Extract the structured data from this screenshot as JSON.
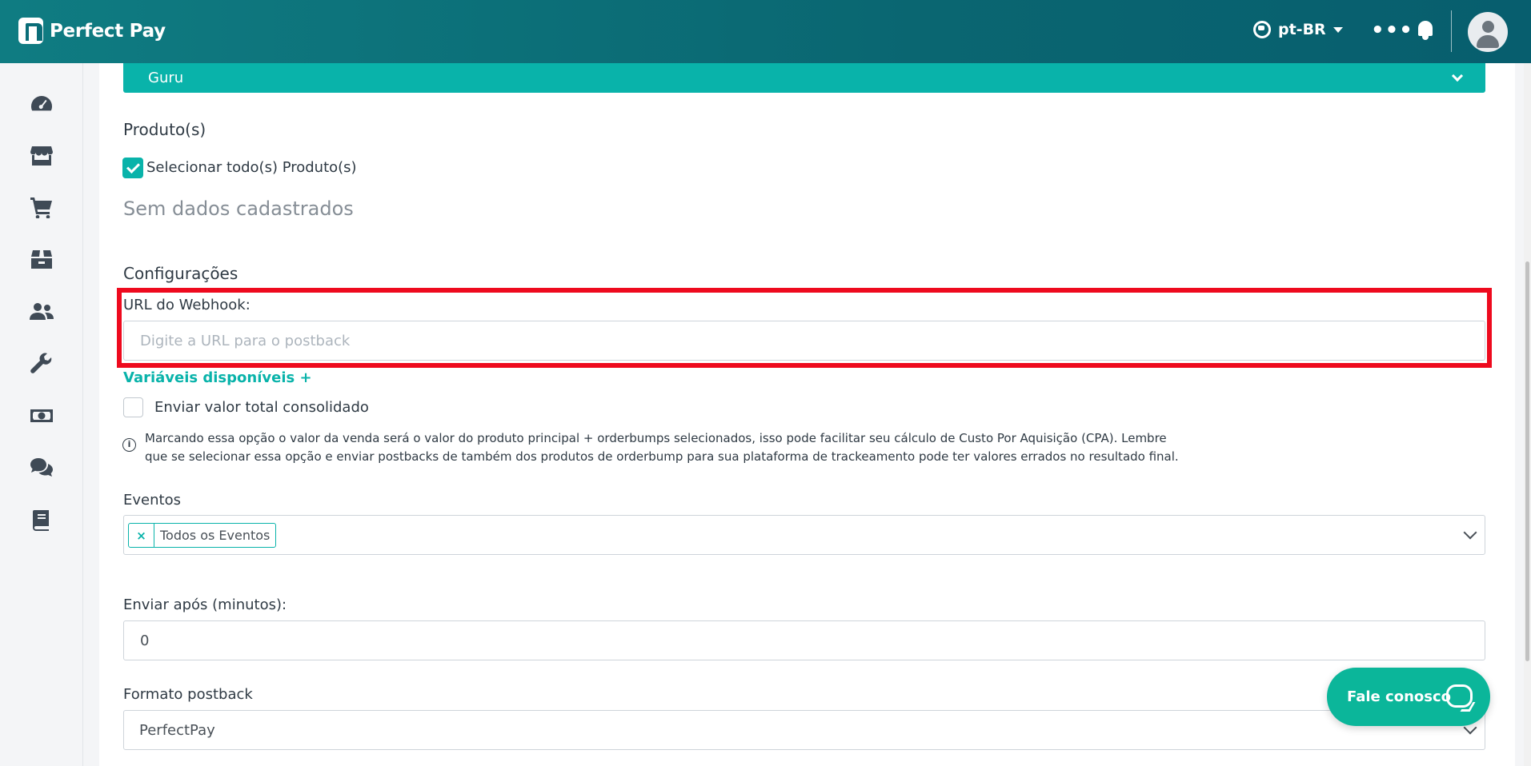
{
  "header": {
    "brand": "Perfect Pay",
    "language": "pt-BR",
    "more_label": "•••"
  },
  "sidebar": {
    "icons": [
      "dashboard-icon",
      "store-icon",
      "cart-icon",
      "box-icon",
      "users-icon",
      "wrench-icon",
      "money-icon",
      "chat-icon",
      "book-icon"
    ]
  },
  "integration": {
    "selected": "Guru"
  },
  "products": {
    "title": "Produto(s)",
    "select_all_label": "Selecionar todo(s) Produto(s)",
    "select_all_checked": true,
    "empty_state": "Sem dados cadastrados"
  },
  "settings": {
    "title": "Configurações",
    "webhook_label": "URL do Webhook:",
    "webhook_value": "",
    "webhook_placeholder": "Digite a URL para o postback",
    "variables_link": "Variáveis disponíveis +",
    "consolidated_label": "Enviar valor total consolidado",
    "consolidated_checked": false,
    "help_text": "Marcando essa opção o valor da venda será o valor do produto principal + orderbumps selecionados, isso pode facilitar seu cálculo de Custo Por Aquisição (CPA). Lembre que se selecionar essa opção e enviar postbacks de também dos produtos de orderbump para sua plataforma de trackeamento pode ter valores errados no resultado final."
  },
  "events": {
    "label": "Eventos",
    "tags": [
      {
        "remove": "×",
        "label": "Todos os Eventos"
      }
    ]
  },
  "delay": {
    "label": "Enviar após (minutos):",
    "value": "0"
  },
  "format": {
    "label": "Formato postback",
    "selected": "PerfectPay"
  },
  "chat": {
    "label": "Fale conosco"
  },
  "colors": {
    "teal": "#09b3aa",
    "header": "#0a6671",
    "highlight": "#ee0a1e",
    "chat": "#0bb69a"
  }
}
